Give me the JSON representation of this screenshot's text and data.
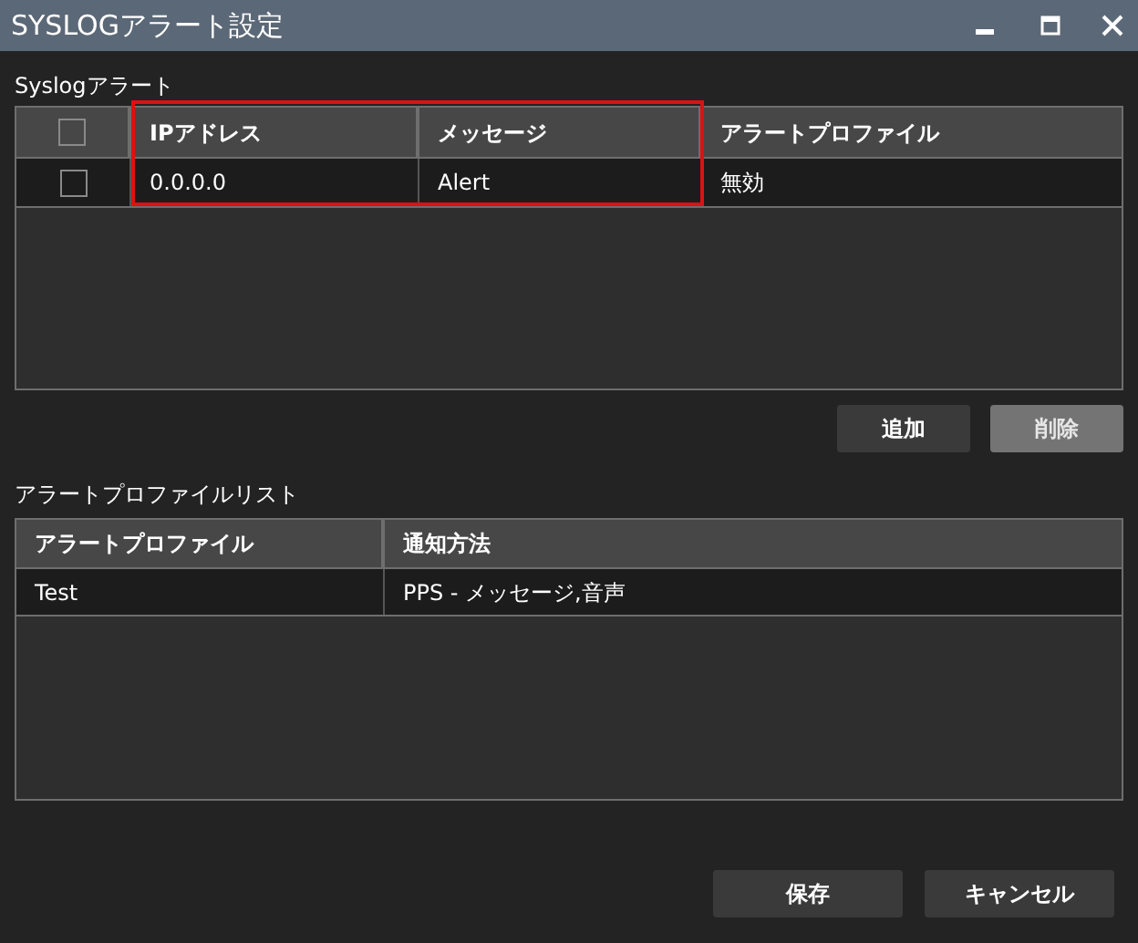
{
  "window": {
    "title": "SYSLOGアラート設定"
  },
  "syslog": {
    "label": "Syslogアラート",
    "header_checkbox": {
      "checked": false
    },
    "columns": [
      "IPアドレス",
      "メッセージ",
      "アラートプロファイル"
    ],
    "rows": [
      {
        "checked": false,
        "cells": [
          "0.0.0.0",
          "Alert",
          "無効"
        ]
      }
    ],
    "buttons": [
      {
        "label": "追加",
        "disabled": false
      },
      {
        "label": "削除",
        "disabled": true
      }
    ]
  },
  "profiles": {
    "label": "アラートプロファイルリスト",
    "columns": [
      "アラートプロファイル",
      "通知方法"
    ],
    "rows": [
      {
        "cells": [
          "Test",
          "PPS - メッセージ,音声"
        ]
      }
    ]
  },
  "footer_buttons": [
    {
      "label": "保存"
    },
    {
      "label": "キャンセル"
    }
  ]
}
